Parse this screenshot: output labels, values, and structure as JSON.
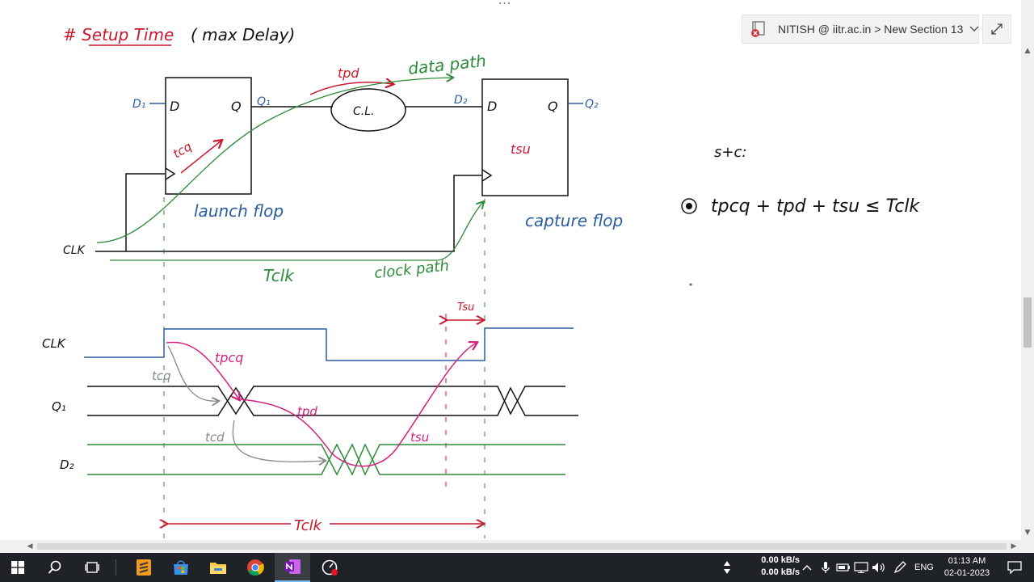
{
  "toolbar": {
    "dots": "···",
    "breadcrumb": "NITISH @ iitr.ac.in > New Section 13",
    "expand_icon": "expand-icon"
  },
  "note": {
    "title": "# Setup Time",
    "title_suffix": "( max Delay)",
    "circuit": {
      "d1": "D₁",
      "d_in_1": "D",
      "q_out_1": "Q",
      "q1": "Q₁",
      "cl": "C.L.",
      "d2": "D₂",
      "d_in_2": "D",
      "q_out_2": "Q",
      "q2": "Q₂",
      "tpd": "tpd",
      "data_path": "data path",
      "tcq": "tcq",
      "tsu": "tsu",
      "launch_flop": "launch flop",
      "capture_flop": "capture flop",
      "clk": "CLK",
      "tclk": "Tclk",
      "clock_path": "clock path"
    },
    "timing": {
      "clk": "CLK",
      "q1": "Q₁",
      "d2": "D₂",
      "tcq": "tcq",
      "tpcq": "tpcq",
      "tpd": "tpd",
      "tcd": "tcd",
      "tsu": "tsu",
      "tsu_top": "Tsu",
      "tclk": "Tclk"
    },
    "condition": {
      "label": "s+c:",
      "equation": "tpcq +  tpd + tsu ≤ Tclk"
    },
    "colors": {
      "red": "#c8192f",
      "blue": "#2a5d9f",
      "green": "#2e8b3a",
      "black": "#111111",
      "magenta": "#d6207e",
      "gray": "#888888"
    }
  },
  "taskbar": {
    "start_icon": "windows-start-icon",
    "search_icon": "search-icon",
    "task_view_icon": "task-view-icon",
    "apps": [
      "sublime-text-icon",
      "microsoft-store-icon",
      "file-explorer-icon",
      "chrome-icon",
      "onenote-icon",
      "screen-recorder-icon"
    ],
    "net_up": "0.00 kB/s",
    "net_down": "0.00 kB/s",
    "lang": "ENG",
    "time": "01:13 AM",
    "date": "02-01-2023"
  }
}
